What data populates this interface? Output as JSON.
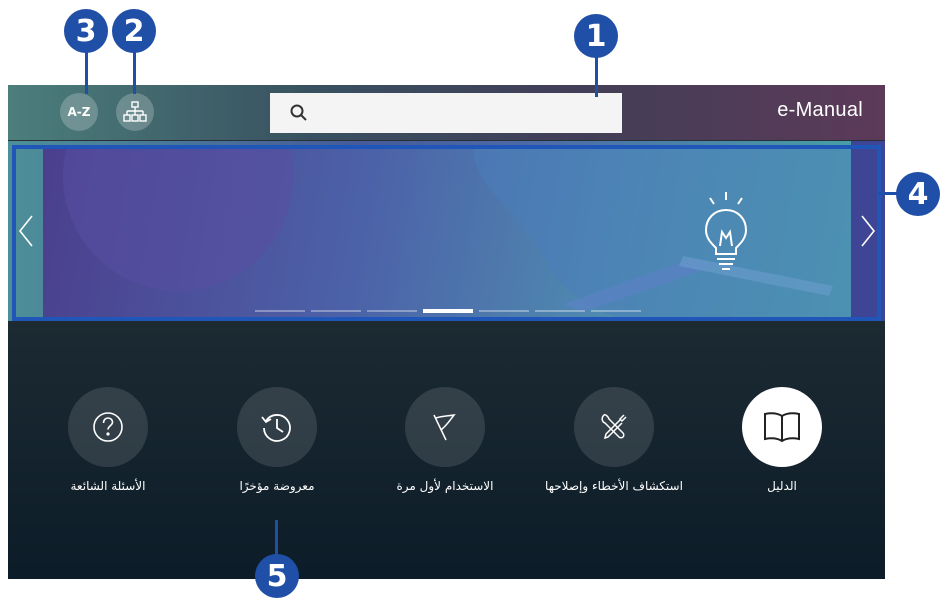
{
  "callouts": [
    "1",
    "2",
    "3",
    "4",
    "5"
  ],
  "header": {
    "az_label": "A-Z",
    "app_title": "e-Manual",
    "search_icon": "search-icon",
    "sitemap_icon": "sitemap-icon"
  },
  "banner": {
    "prev_label": "‹",
    "next_label": "›",
    "illustration": "lightbulb-icon",
    "page_count": 7,
    "active_page": 4
  },
  "menu": {
    "items": [
      {
        "label": "الأسئلة الشائعة",
        "icon": "question-icon"
      },
      {
        "label": "معروضة مؤخرًا",
        "icon": "history-icon"
      },
      {
        "label": "الاستخدام لأول مرة",
        "icon": "flag-icon"
      },
      {
        "label": "استكشاف الأخطاء وإصلاحها",
        "icon": "tools-icon"
      },
      {
        "label": "الدليل",
        "icon": "book-icon"
      }
    ]
  },
  "colors": {
    "callout": "#1f4fa6",
    "selected_item": "#ffffff"
  }
}
